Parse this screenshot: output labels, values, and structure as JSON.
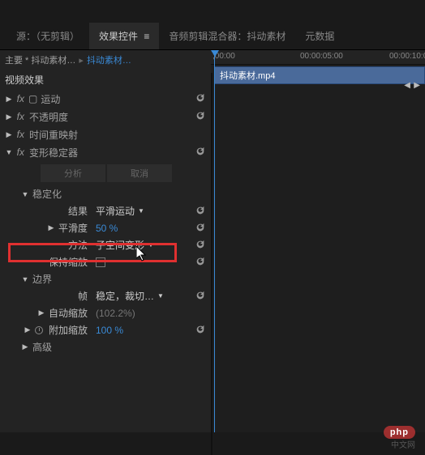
{
  "tabs": {
    "source": "源：（无剪辑）",
    "effect_controls": "效果控件",
    "audio_mixer": "音频剪辑混合器：抖动素材",
    "metadata": "元数据"
  },
  "breadcrumb": {
    "main_label": "主要 * 抖动素材…",
    "clip_label": "抖动素材…"
  },
  "sections": {
    "video_effects": "视频效果",
    "motion": "运动",
    "opacity": "不透明度",
    "time_remap": "时间重映射",
    "warp_stabilizer": "变形稳定器"
  },
  "buttons": {
    "analyze": "分析",
    "cancel": "取消"
  },
  "warp": {
    "stabilization_header": "稳定化",
    "result_label": "结果",
    "result_value": "平滑运动",
    "smoothness_label": "平滑度",
    "smoothness_value": "50 %",
    "method_label": "方法",
    "method_value": "子空间变形",
    "preserve_scale_label": "保持缩放",
    "border_header": "边界",
    "frame_label": "帧",
    "frame_value": "稳定，裁切…",
    "auto_scale_label": "自动缩放",
    "auto_scale_value": "(102.2%)",
    "extra_scale_label": "附加缩放",
    "extra_scale_value": "100 %",
    "advanced_header": "高级"
  },
  "timeline": {
    "t0": ";00:00",
    "t5": "00:00:05:00",
    "t10": "00:00:10:0",
    "clip_name": "抖动素材.mp4"
  },
  "watermark": {
    "brand": "php",
    "site": "中文网"
  }
}
